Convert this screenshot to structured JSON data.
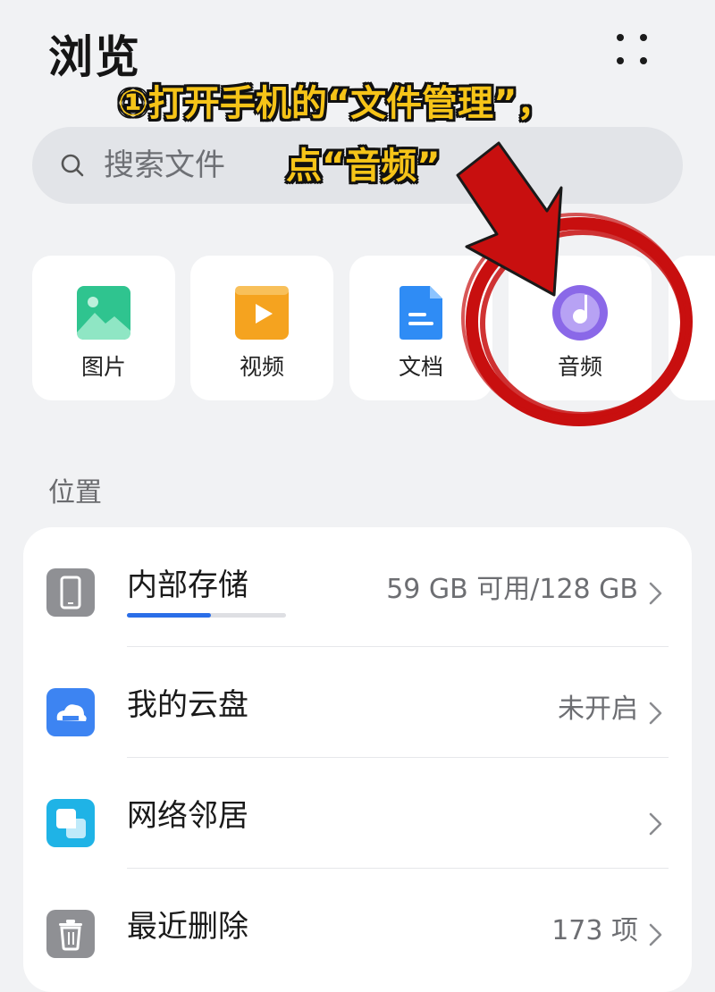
{
  "header": {
    "title": "浏览",
    "more_icon": "grid-dots-icon"
  },
  "search": {
    "placeholder": "搜索文件",
    "icon": "search-icon"
  },
  "annotation": {
    "line1": "①打开手机的“文件管理”，",
    "line2": "点“音频”",
    "text_color": "#f6c418",
    "mark_color": "#c80f0f"
  },
  "categories": [
    {
      "label": "图片",
      "icon": "image-icon",
      "color": "#2fc48f"
    },
    {
      "label": "视频",
      "icon": "video-icon",
      "color": "#f5a31f"
    },
    {
      "label": "文档",
      "icon": "document-icon",
      "color": "#2f8cf5"
    },
    {
      "label": "音频",
      "icon": "audio-icon",
      "color": "#8a68e8"
    }
  ],
  "locations": {
    "title": "位置",
    "items": [
      {
        "label": "内部存储",
        "value": "59 GB 可用/128 GB",
        "icon": "phone-icon",
        "usage_fraction": 0.53
      },
      {
        "label": "我的云盘",
        "value": "未开启",
        "icon": "cloud-drive-icon"
      },
      {
        "label": "网络邻居",
        "value": "",
        "icon": "network-neighbor-icon"
      },
      {
        "label": "最近删除",
        "value": "173 项",
        "icon": "trash-icon"
      }
    ]
  }
}
